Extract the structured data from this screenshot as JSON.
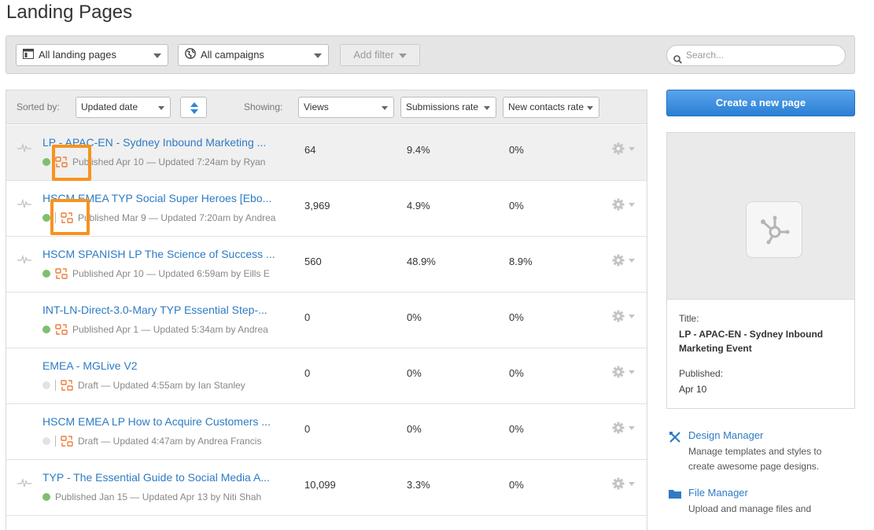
{
  "page": {
    "title": "Landing Pages"
  },
  "filters": {
    "pages_dropdown": "All landing pages",
    "campaigns_dropdown": "All campaigns",
    "add_filter": "Add filter",
    "search_placeholder": "Search..."
  },
  "list_header": {
    "sorted_by_label": "Sorted by:",
    "sort_value": "Updated date",
    "showing_label": "Showing:",
    "col1": "Views",
    "col2": "Submissions rate",
    "col3": "New contacts rate"
  },
  "rows": [
    {
      "name": "LP - APAC-EN - Sydney Inbound Marketing ...",
      "meta": "Published Apr 10 — Updated 7:24am by Ryan",
      "views": "64",
      "submissions": "9.4%",
      "contacts": "0%",
      "status": "green"
    },
    {
      "name": "HSCM EMEA TYP Social Super Heroes [Ebo...",
      "meta": "Published Mar 9 — Updated 7:20am by Andrea",
      "views": "3,969",
      "submissions": "4.9%",
      "contacts": "0%",
      "status": "green"
    },
    {
      "name": "HSCM SPANISH LP The Science of Success ...",
      "meta": "Published Apr 10 — Updated 6:59am by Eills E",
      "views": "560",
      "submissions": "48.9%",
      "contacts": "8.9%",
      "status": "green"
    },
    {
      "name": "INT-LN-Direct-3.0-Mary TYP Essential Step-...",
      "meta": "Published Apr 1 — Updated 5:34am by Andrea",
      "views": "0",
      "submissions": "0%",
      "contacts": "0%",
      "status": "green"
    },
    {
      "name": "EMEA - MGLive V2",
      "meta": "Draft — Updated 4:55am by Ian Stanley",
      "views": "0",
      "submissions": "0%",
      "contacts": "0%",
      "status": "grey"
    },
    {
      "name": "HSCM EMEA LP How to Acquire Customers ...",
      "meta": "Draft — Updated 4:47am by Andrea Francis",
      "views": "0",
      "submissions": "0%",
      "contacts": "0%",
      "status": "grey"
    },
    {
      "name": "TYP - The Essential Guide to Social Media A...",
      "meta": "Published Jan 15 — Updated Apr 13 by Niti Shah",
      "views": "10,099",
      "submissions": "3.3%",
      "contacts": "0%",
      "status": "green"
    }
  ],
  "sidebar": {
    "create_button": "Create a new page",
    "preview": {
      "title_label": "Title:",
      "title_value": "LP - APAC-EN - Sydney Inbound Marketing Event",
      "published_label": "Published:",
      "published_value": "Apr 10"
    },
    "tools": [
      {
        "title": "Design Manager",
        "desc": "Manage templates and styles to create awesome page designs.",
        "icon": "design-manager-icon"
      },
      {
        "title": "File Manager",
        "desc": "Upload and manage files and",
        "icon": "folder-icon"
      }
    ]
  },
  "colors": {
    "link": "#2e7bc4",
    "highlight": "#f7931e",
    "ab_icon": "#f07d3a",
    "published_dot": "#7fbf6e"
  }
}
